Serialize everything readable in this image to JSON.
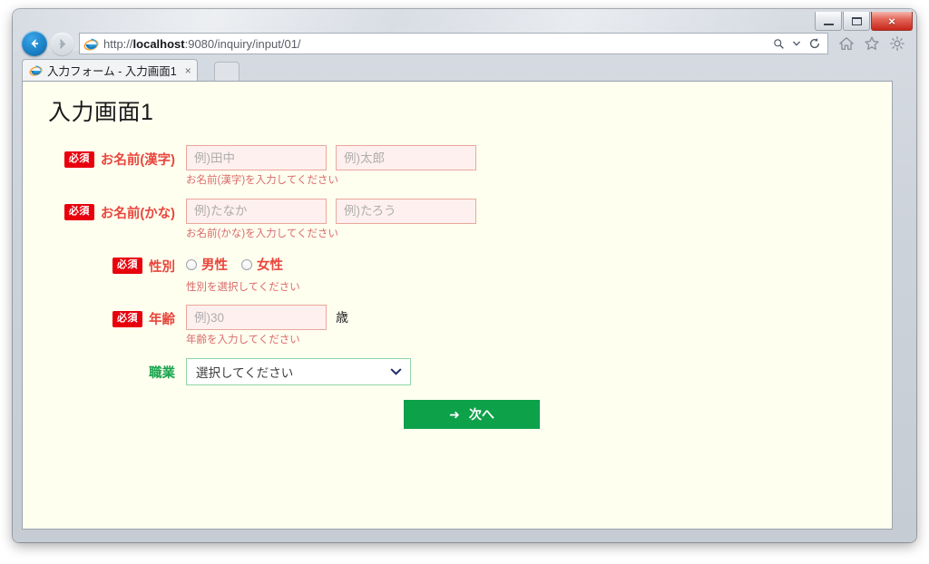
{
  "window": {
    "minimize_label": "最小化",
    "maximize_label": "最大化",
    "close_label": "×"
  },
  "browser": {
    "back_label": "←",
    "forward_label": "→",
    "url": "http://localhost:9080/inquiry/input/01/",
    "url_domain": "localhost",
    "url_prefix": "http://",
    "url_suffix": ":9080/inquiry/input/01/",
    "search_icon": "search-icon",
    "dropdown_icon": "chevron-down-icon",
    "refresh_icon": "refresh-icon",
    "home_icon": "home-icon",
    "favorites_icon": "star-icon",
    "settings_icon": "gear-icon",
    "tab": {
      "title": "入力フォーム - 入力画面1",
      "close_label": "×"
    }
  },
  "page": {
    "title": "入力画面1",
    "required_badge": "必須",
    "rows": [
      {
        "label": "お名前(漢字)",
        "required": true,
        "hint": "お名前(漢字)を入力してください",
        "inputs": [
          {
            "value": "",
            "placeholder": "例)田中"
          },
          {
            "value": "",
            "placeholder": "例)太郎"
          }
        ]
      },
      {
        "label": "お名前(かな)",
        "required": true,
        "hint": "お名前(かな)を入力してください",
        "inputs": [
          {
            "value": "",
            "placeholder": "例)たなか"
          },
          {
            "value": "",
            "placeholder": "例)たろう"
          }
        ]
      },
      {
        "label": "性別",
        "required": true,
        "hint": "性別を選択してください",
        "radios": [
          {
            "label": "男性",
            "checked": false
          },
          {
            "label": "女性",
            "checked": false
          }
        ]
      },
      {
        "label": "年齢",
        "required": true,
        "hint": "年齢を入力してください",
        "inputs": [
          {
            "value": "",
            "placeholder": "例)30"
          }
        ],
        "unit": "歳"
      },
      {
        "label": "職業",
        "required": false,
        "select": {
          "selected": "選択してください"
        }
      }
    ],
    "submit": {
      "label": "次へ",
      "arrow": "➜"
    }
  },
  "colors": {
    "required_badge_bg": "#e8000d",
    "required_label": "#e8463c",
    "optional_label": "#17a44c",
    "hint_text": "#d96a6a",
    "input_bg": "#fdf0ee",
    "input_border": "#eaa79c",
    "select_border": "#8fd6a8",
    "submit_bg": "#0da14a",
    "page_bg": "#fffff0"
  }
}
